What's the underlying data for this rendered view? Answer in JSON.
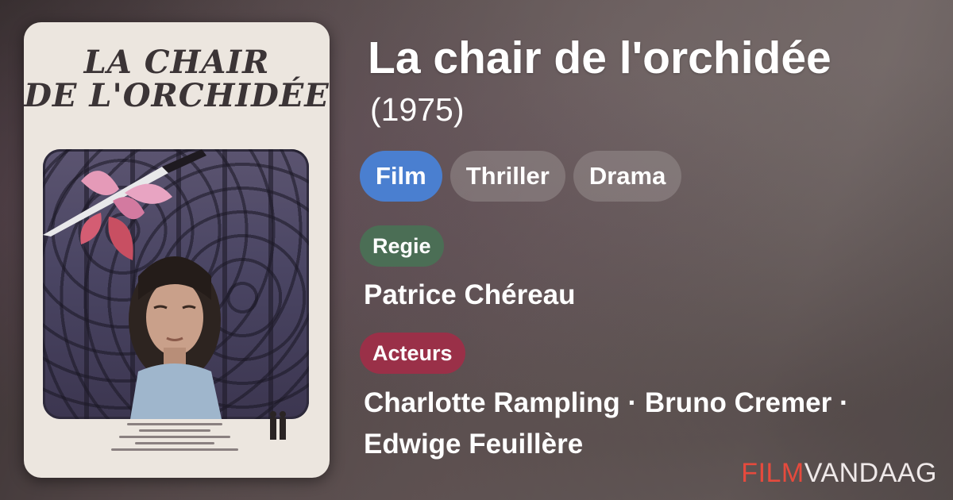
{
  "movie": {
    "title": "La chair de l'orchidée",
    "year": "(1975)"
  },
  "poster": {
    "title_line1": "LA CHAIR",
    "title_line2": "DE L'ORCHIDÉE"
  },
  "tags": [
    "Film",
    "Thriller",
    "Drama"
  ],
  "regie": {
    "label": "Regie",
    "value": "Patrice Chéreau"
  },
  "acteurs": {
    "label": "Acteurs",
    "line1": "Charlotte Rampling · Bruno Cremer ·",
    "line2": "Edwige Feuillère"
  },
  "brand": {
    "part1": "FILM",
    "part2": "VANDAAG"
  },
  "colors": {
    "tag_primary": "#4a7fd0",
    "regie": "#4b6e55",
    "acteurs": "#9a3048",
    "brand_accent": "#e64a3d"
  }
}
